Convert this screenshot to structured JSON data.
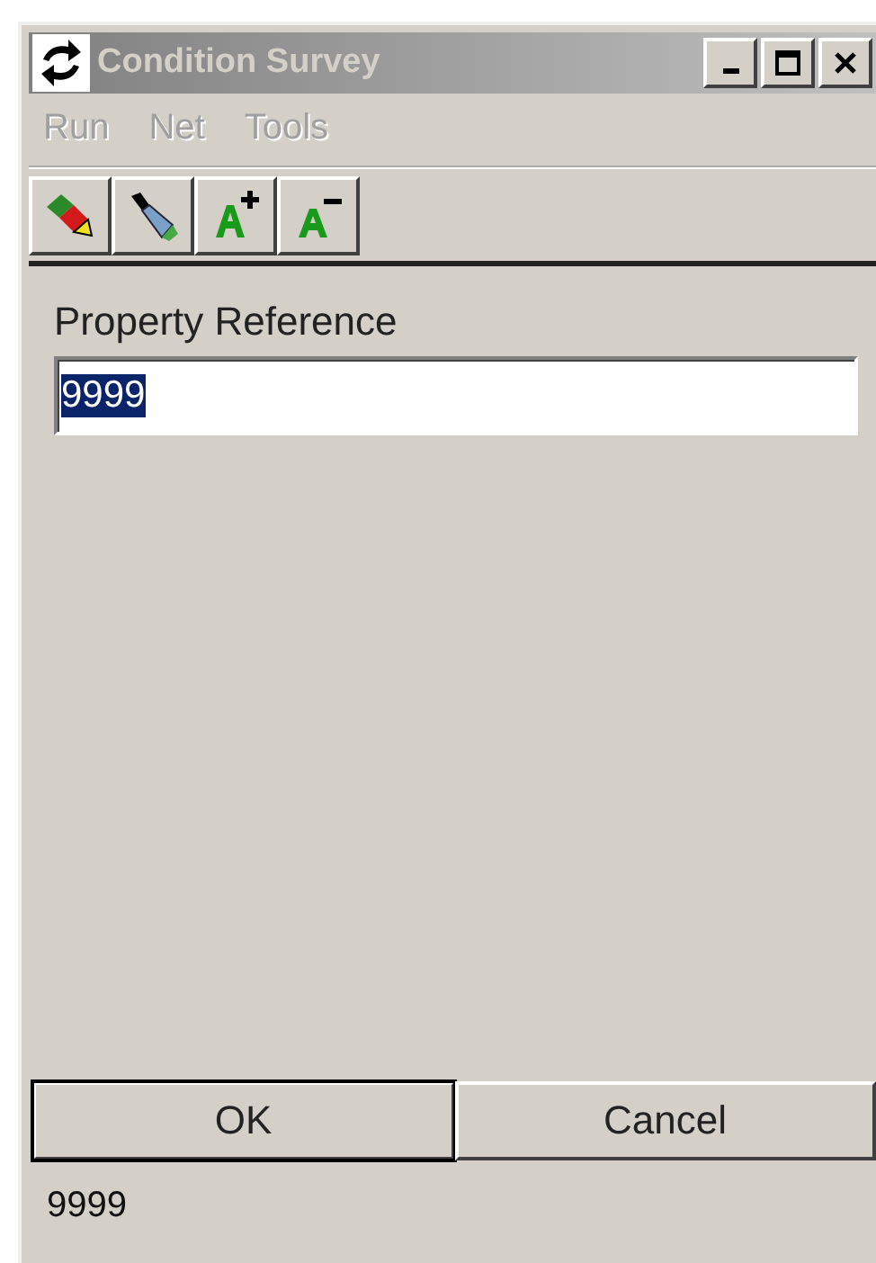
{
  "window": {
    "title": "Condition Survey",
    "active": false
  },
  "menu": [
    {
      "label": "Run",
      "disabled": true
    },
    {
      "label": "Net",
      "disabled": true
    },
    {
      "label": "Tools",
      "disabled": true
    }
  ],
  "toolbar": [
    {
      "kind": "eraser"
    },
    {
      "kind": "brush"
    },
    {
      "kind": "font-larger"
    },
    {
      "kind": "font-smaller"
    }
  ],
  "form": {
    "label": "Property Reference",
    "value": "9999",
    "selected": true
  },
  "buttons": [
    {
      "label": "OK",
      "default": true
    },
    {
      "label": "Cancel",
      "default": false
    }
  ],
  "status_bar": "9999"
}
